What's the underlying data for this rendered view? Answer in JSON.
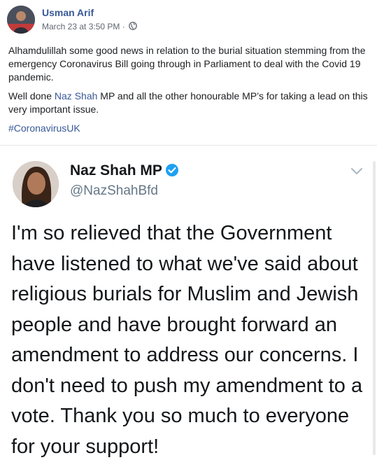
{
  "post": {
    "author": "Usman Arif",
    "timestamp": "March 23 at 3:50 PM",
    "meta_separator": "·",
    "privacy_icon": "globe-icon",
    "paragraph1": "Alhamdulillah some good news in relation to the burial situation stemming from the emergency Coronavirus Bill going through in Parliament to deal with the Covid 19 pandemic.",
    "paragraph2_prefix": "Well done ",
    "paragraph2_link": "Naz Shah",
    "paragraph2_suffix": " MP and all the other honourable MP’s for taking a lead on this very important issue.",
    "hashtag": "#CoronavirusUK"
  },
  "tweet": {
    "name": "Naz Shah MP",
    "handle": "@NazShahBfd",
    "verified_icon": "verified-badge-icon",
    "menu_icon": "chevron-down-icon",
    "lines": [
      "I'm so relieved that the Government",
      "have listened to what we've said about",
      "religious burials for Muslim and Jewish",
      "people and have brought forward an",
      "amendment to address our concerns. I",
      "don't need to push my amendment to a",
      "vote. Thank you so much to everyone",
      "for your support!"
    ]
  },
  "colors": {
    "link": "#385898",
    "meta": "#606770",
    "verified": "#1da1f2",
    "tweet_text": "#14171a",
    "tweet_handle": "#657786"
  }
}
